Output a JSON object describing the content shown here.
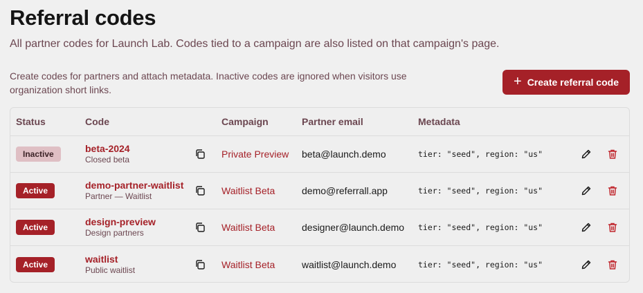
{
  "page": {
    "title": "Referral codes",
    "subtitle": "All partner codes for Launch Lab. Codes tied to a campaign are also listed on that campaign's page.",
    "helper": "Create codes for partners and attach metadata. Inactive codes are ignored when visitors use organization short links.",
    "create_button_label": "Create referral code",
    "create_button_icon": "+"
  },
  "table": {
    "headers": {
      "status": "Status",
      "code": "Code",
      "campaign": "Campaign",
      "email": "Partner email",
      "metadata": "Metadata"
    },
    "rows": [
      {
        "status": "Inactive",
        "status_kind": "inactive",
        "code": "beta-2024",
        "description": "Closed beta",
        "campaign": "Private Preview",
        "email": "beta@launch.demo",
        "metadata": "tier: \"seed\", region: \"us\""
      },
      {
        "status": "Active",
        "status_kind": "active",
        "code": "demo-partner-waitlist",
        "description": "Partner — Waitlist",
        "campaign": "Waitlist Beta",
        "email": "demo@referrall.app",
        "metadata": "tier: \"seed\", region: \"us\""
      },
      {
        "status": "Active",
        "status_kind": "active",
        "code": "design-preview",
        "description": "Design partners",
        "campaign": "Waitlist Beta",
        "email": "designer@launch.demo",
        "metadata": "tier: \"seed\", region: \"us\""
      },
      {
        "status": "Active",
        "status_kind": "active",
        "code": "waitlist",
        "description": "Public waitlist",
        "campaign": "Waitlist Beta",
        "email": "waitlist@launch.demo",
        "metadata": "tier: \"seed\", region: \"us\""
      }
    ]
  },
  "icons": {
    "copy": "copy-icon",
    "edit": "pencil-icon",
    "delete": "trash-icon"
  },
  "colors": {
    "accent": "#a52128",
    "muted_text": "#6b4650",
    "inactive_badge": "#dfbfc4",
    "background": "#f0f0f0"
  }
}
